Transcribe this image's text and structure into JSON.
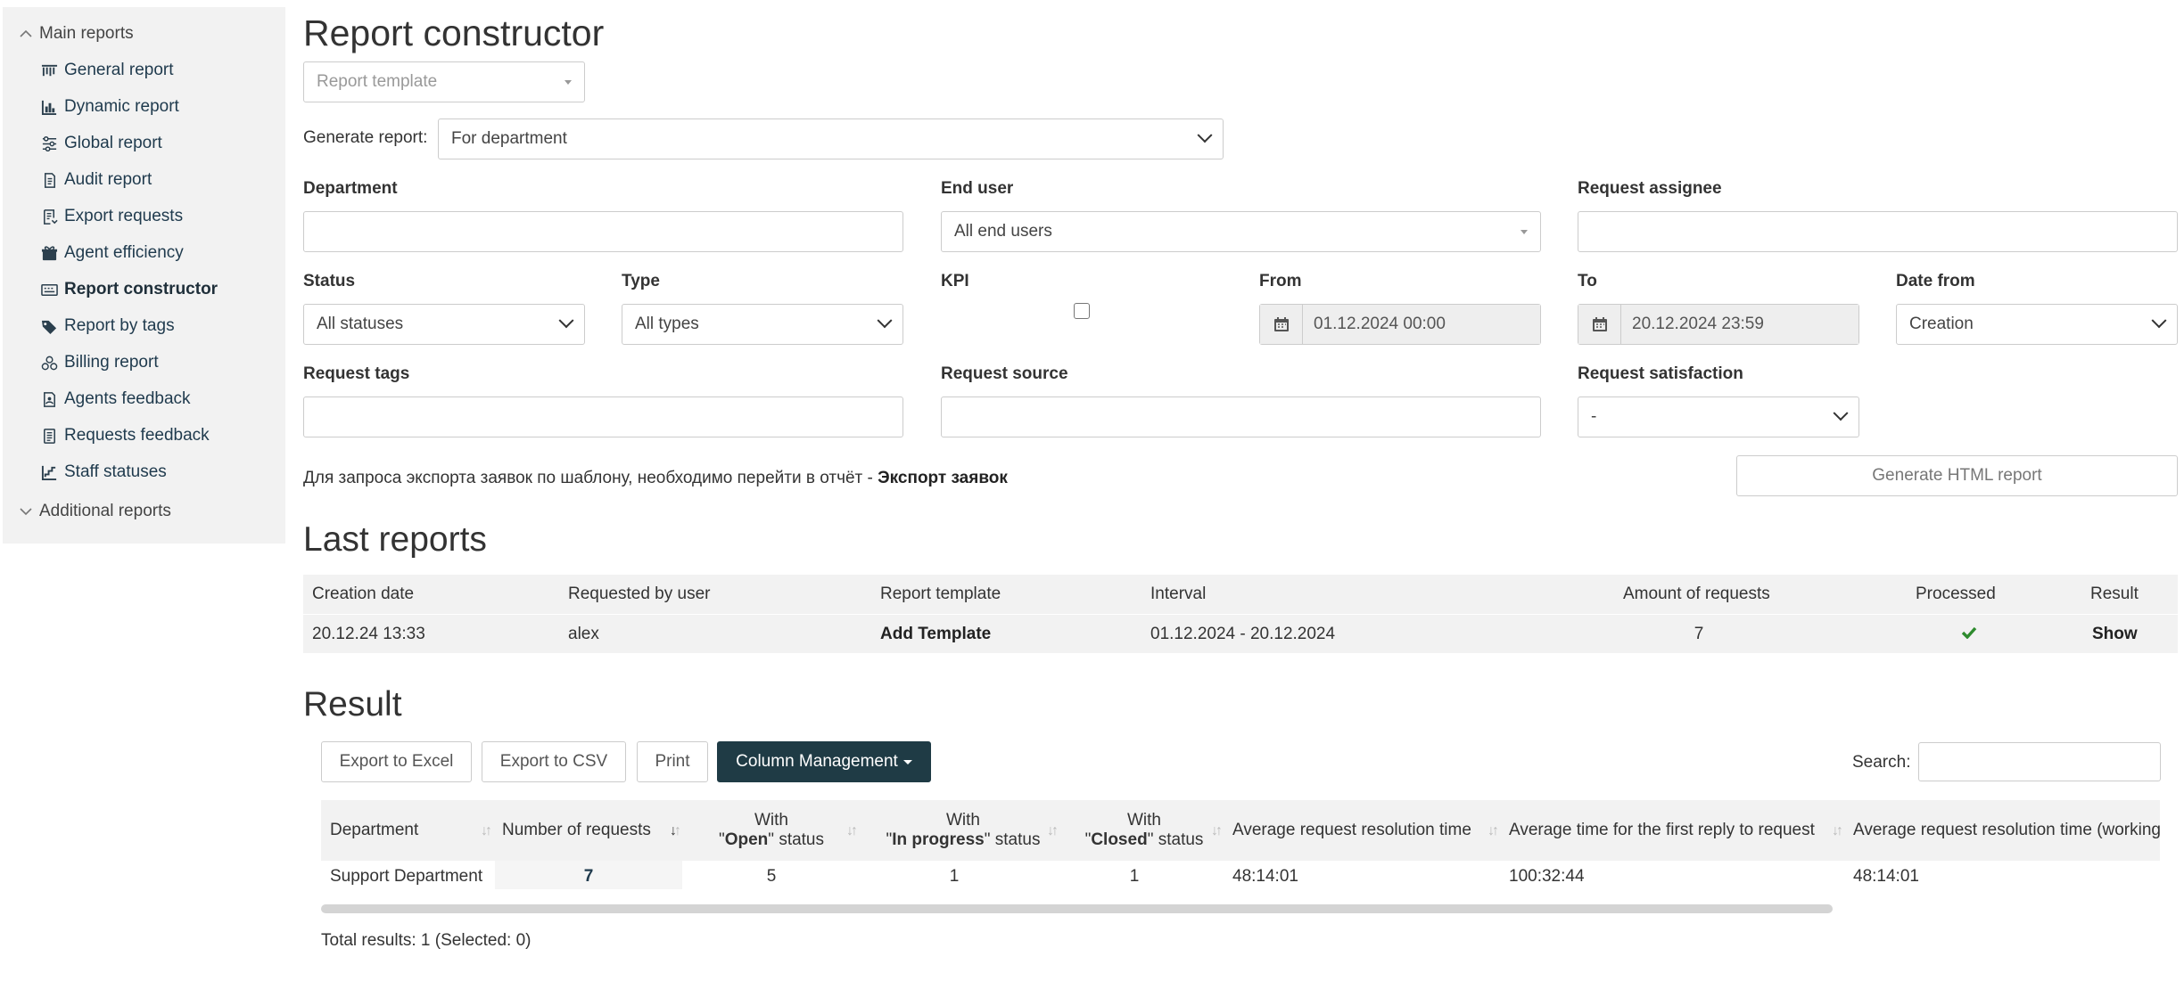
{
  "sidebar": {
    "main_group": "Main reports",
    "additional_group": "Additional reports",
    "items": [
      {
        "label": "General report",
        "icon": "bar-ruler-icon"
      },
      {
        "label": "Dynamic report",
        "icon": "bar-chart-icon"
      },
      {
        "label": "Global report",
        "icon": "sliders-icon"
      },
      {
        "label": "Audit report",
        "icon": "document-icon"
      },
      {
        "label": "Export requests",
        "icon": "export-list-icon"
      },
      {
        "label": "Agent efficiency",
        "icon": "gift-box-icon"
      },
      {
        "label": "Report constructor",
        "icon": "keyboard-icon"
      },
      {
        "label": "Report by tags",
        "icon": "tags-icon"
      },
      {
        "label": "Billing report",
        "icon": "coins-icon"
      },
      {
        "label": "Agents feedback",
        "icon": "feedback-doc-icon"
      },
      {
        "label": "Requests feedback",
        "icon": "list-doc-icon"
      },
      {
        "label": "Staff statuses",
        "icon": "staircase-chart-icon"
      }
    ]
  },
  "page": {
    "title": "Report constructor",
    "template_placeholder": "Report template",
    "generate_label": "Generate report:",
    "generate_value": "For department"
  },
  "filters": {
    "department_label": "Department",
    "end_user_label": "End user",
    "end_user_value": "All end users",
    "assignee_label": "Request assignee",
    "status_label": "Status",
    "status_value": "All statuses",
    "type_label": "Type",
    "type_value": "All types",
    "kpi_label": "KPI",
    "from_label": "From",
    "from_value": "01.12.2024 00:00",
    "to_label": "To",
    "to_value": "20.12.2024 23:59",
    "date_from_label": "Date from",
    "date_from_value": "Creation",
    "tags_label": "Request tags",
    "source_label": "Request source",
    "satisfaction_label": "Request satisfaction",
    "satisfaction_value": "-"
  },
  "note": {
    "text": "Для запроса экспорта заявок по шаблону, необходимо перейти в отчёт -",
    "link": "Экспорт заявок"
  },
  "generate_button": "Generate HTML report",
  "last_reports": {
    "title": "Last reports",
    "columns": [
      "Creation date",
      "Requested by user",
      "Report template",
      "Interval",
      "Amount of requests",
      "Processed",
      "Result"
    ],
    "row": {
      "creation_date": "20.12.24 13:33",
      "user": "alex",
      "template": "Add Template",
      "interval": "01.12.2024 - 20.12.2024",
      "amount": "7",
      "processed_icon": "check-icon",
      "result": "Show"
    }
  },
  "result": {
    "title": "Result",
    "buttons": {
      "excel": "Export to Excel",
      "csv": "Export to CSV",
      "print": "Print",
      "columns": "Column Management"
    },
    "search_label": "Search:",
    "headers": {
      "department": "Department",
      "num_requests": "Number of requests",
      "with": "With",
      "open": "Open",
      "in_progress": "In progress",
      "closed": "Closed",
      "status_word": "status",
      "avg_resolution": "Average request resolution time",
      "avg_first_reply": "Average time for the first reply to request",
      "avg_resolution_wh": "Average request resolution time (working hours o"
    },
    "row": {
      "department": "Support Department",
      "num_requests": "7",
      "open": "5",
      "in_progress": "1",
      "closed": "1",
      "avg_resolution": "48:14:01",
      "avg_first_reply": "100:32:44",
      "avg_resolution_wh": "48:14:01"
    },
    "total": "Total results: 1 (Selected: 0)"
  },
  "colors": {
    "sidebar_bg": "#f2f2f2",
    "dark_button": "#1f3b45",
    "check": "#2e8b2e"
  }
}
